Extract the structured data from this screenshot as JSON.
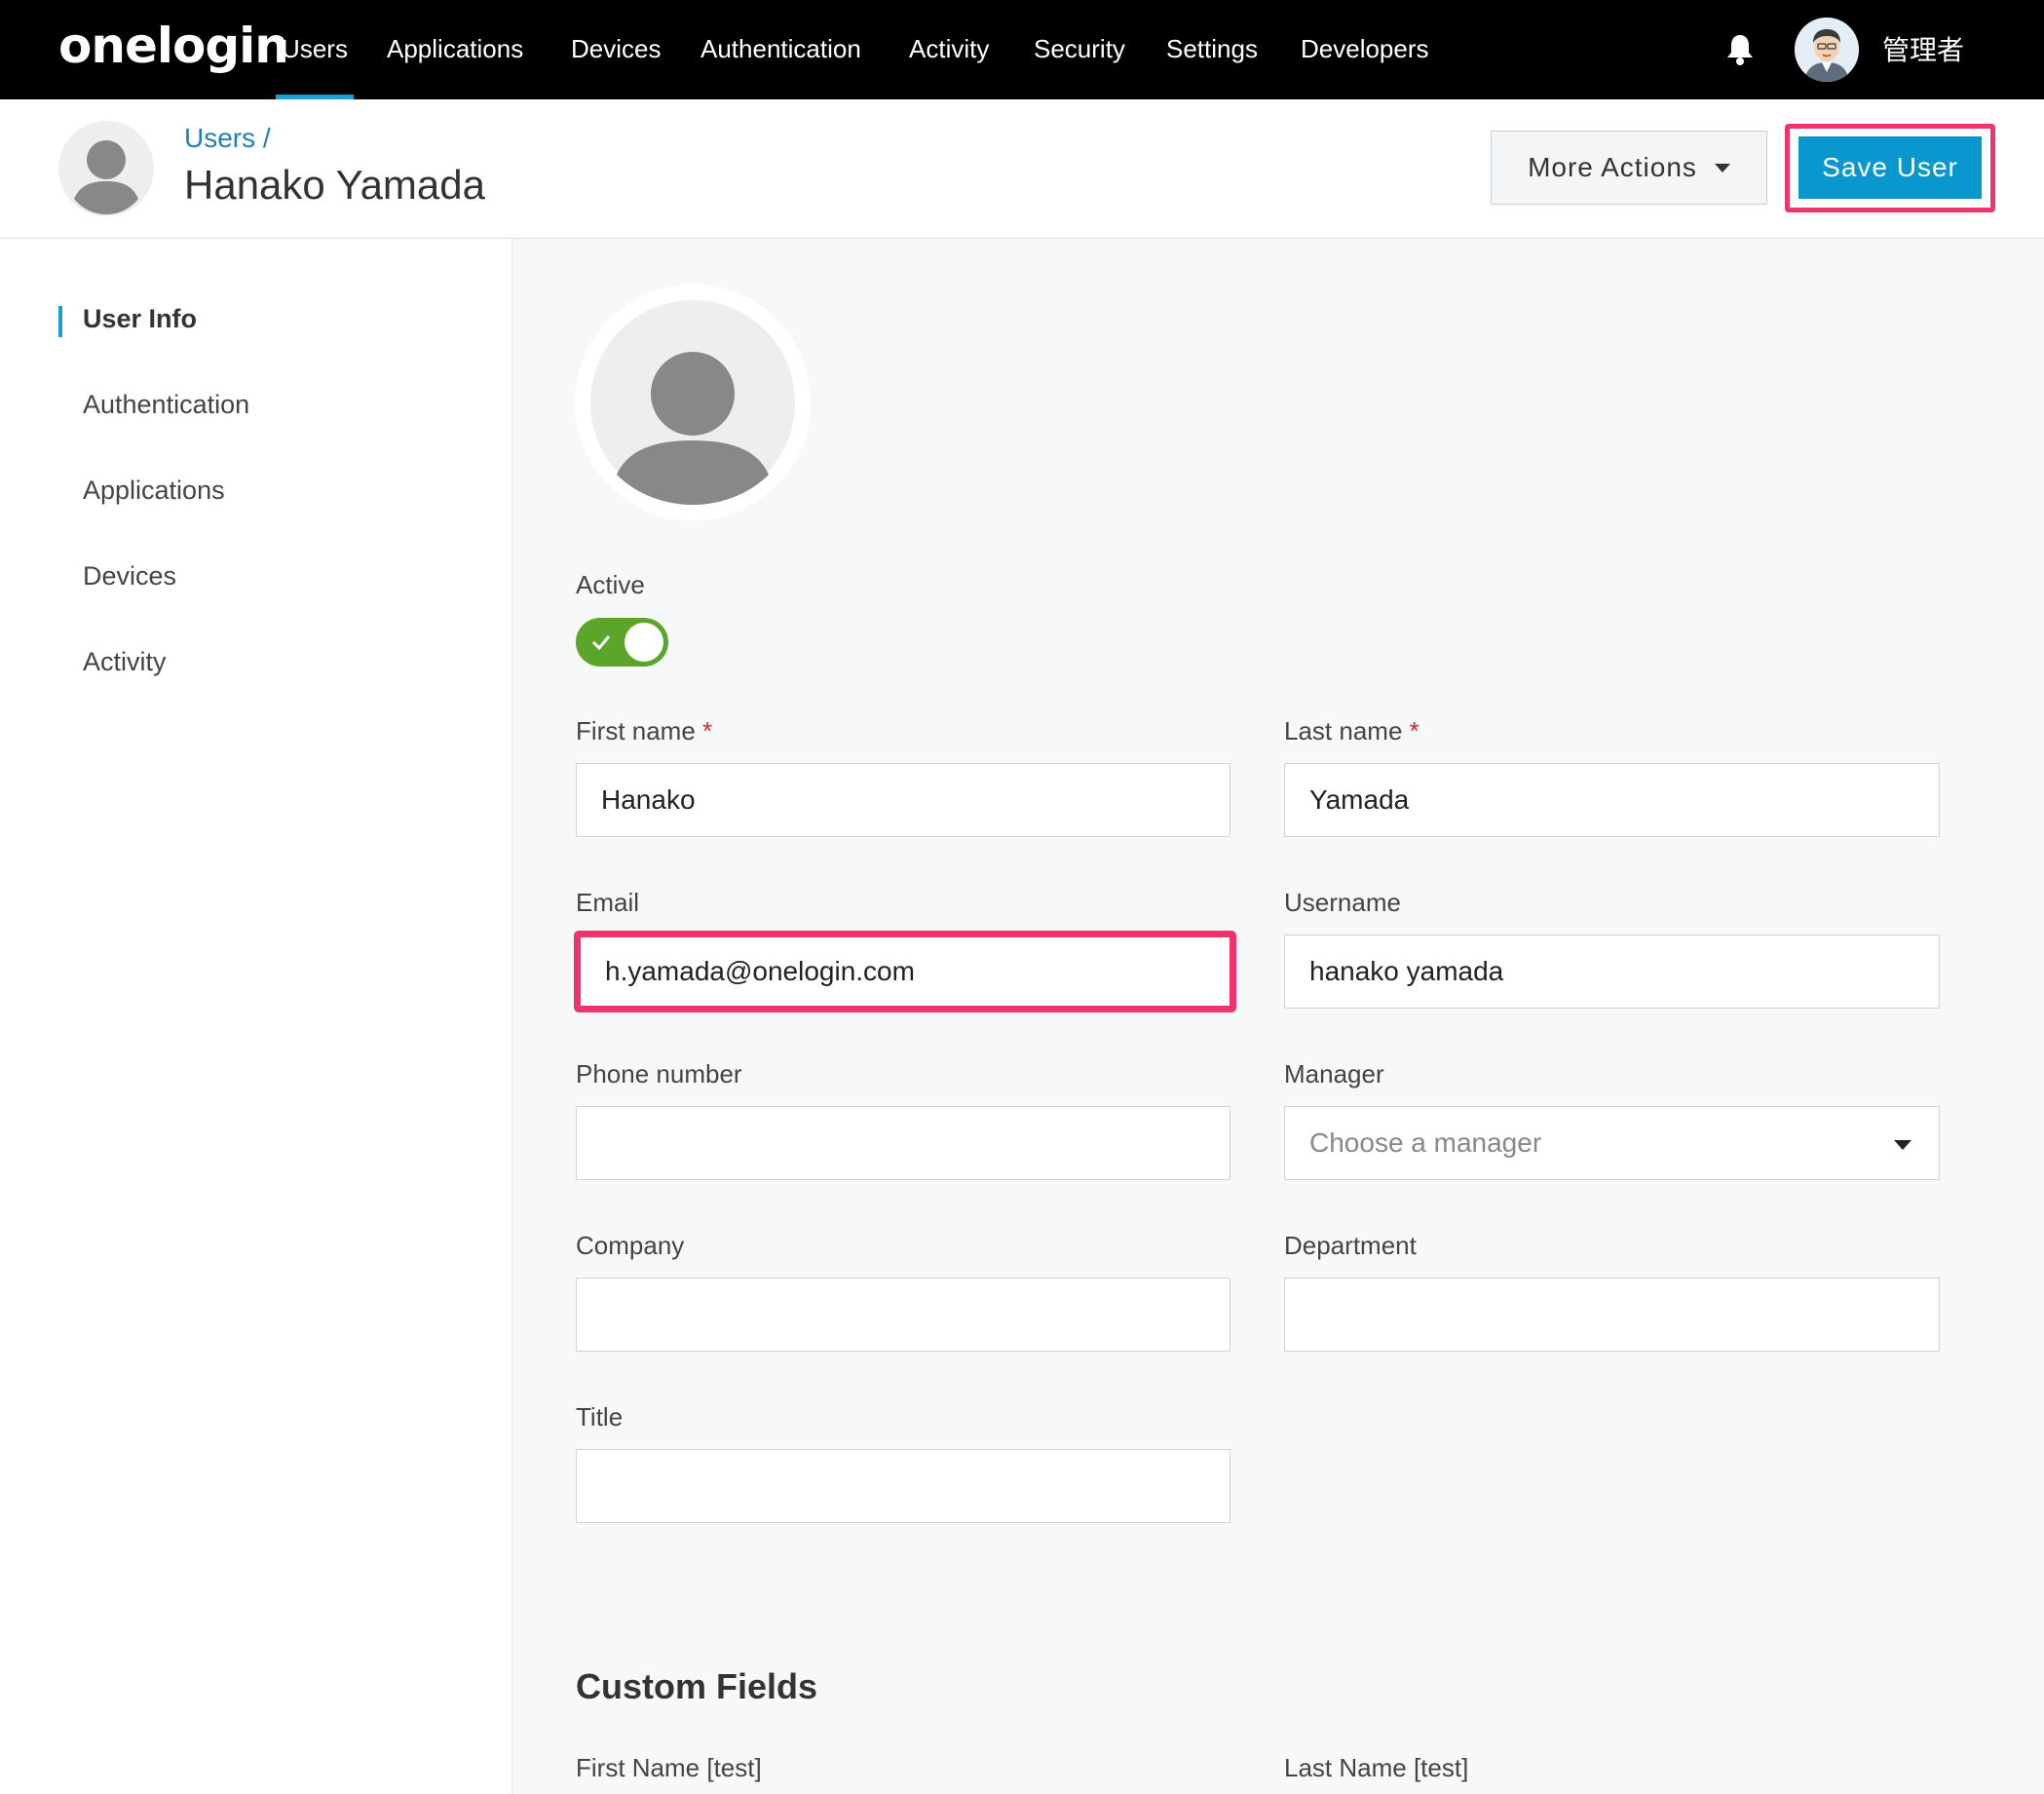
{
  "nav": {
    "logo": "onelogin",
    "items": [
      "Users",
      "Applications",
      "Devices",
      "Authentication",
      "Activity",
      "Security",
      "Settings",
      "Developers"
    ],
    "admin_name": "管理者",
    "accent": "#1a9ed8"
  },
  "header": {
    "breadcrumb": "Users /",
    "title": "Hanako Yamada",
    "more_actions_label": "More Actions",
    "save_label": "Save User",
    "highlight_color": "#f0336b",
    "save_color": "#0a96cf"
  },
  "sidebar": {
    "items": [
      "User Info",
      "Authentication",
      "Applications",
      "Devices",
      "Activity"
    ]
  },
  "form": {
    "active_label": "Active",
    "active_toggle_color": "#5aa52a",
    "first_name_label": "First name",
    "first_name_value": "Hanako",
    "last_name_label": "Last name",
    "last_name_value": "Yamada",
    "required_marker": "*",
    "email_label": "Email",
    "email_value": "h.yamada@onelogin.com",
    "username_label": "Username",
    "username_value": "hanako yamada",
    "phone_label": "Phone number",
    "phone_value": "",
    "manager_label": "Manager",
    "manager_placeholder": "Choose a manager",
    "company_label": "Company",
    "company_value": "",
    "department_label": "Department",
    "department_value": "",
    "title_label": "Title",
    "title_value": ""
  },
  "custom_fields": {
    "heading": "Custom Fields",
    "first_name_test_label": "First Name [test]",
    "last_name_test_label": "Last Name [test]"
  }
}
